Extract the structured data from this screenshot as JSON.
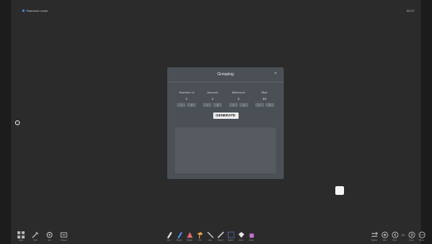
{
  "top": {
    "mode_label": "Standard mode",
    "time": "00:27"
  },
  "dialog": {
    "title": "Grouping",
    "close_symbol": "×",
    "params": [
      {
        "label": "Number of",
        "value": "1"
      },
      {
        "label": "Amount",
        "value": "1"
      },
      {
        "label": "Minimum",
        "value": "2"
      },
      {
        "label": "Max",
        "value": "10"
      }
    ],
    "decrement_symbol": "−",
    "increment_symbol": "+",
    "generate_label": "GENERATE"
  },
  "toolbar_left": [
    {
      "icon": "grid-icon",
      "label": "Apps"
    },
    {
      "icon": "tools-icon",
      "label": "Tool"
    },
    {
      "icon": "settings-icon",
      "label": "Set"
    },
    {
      "icon": "screenshot-icon",
      "label": "Screen"
    }
  ],
  "toolbar_center": [
    {
      "icon": "pen-icon",
      "label": "Pen",
      "color": "#e8e8e8"
    },
    {
      "icon": "brush-icon",
      "label": "Brush",
      "color": "#4a8fe0"
    },
    {
      "icon": "shape-icon",
      "label": "Shape",
      "color": "#e06a6a"
    },
    {
      "icon": "fill-icon",
      "label": "Fill",
      "color": "#e0a04a"
    },
    {
      "icon": "line-icon",
      "label": "Line",
      "color": "#cfcfcf"
    },
    {
      "icon": "pencil-icon",
      "label": "Pencil",
      "color": "#d8d8d8"
    },
    {
      "icon": "select-icon",
      "label": "Select",
      "color": "#6a88e0"
    },
    {
      "icon": "undo-icon",
      "label": "Undo",
      "color": "#e8e8e8"
    },
    {
      "icon": "eraser-icon",
      "label": "Clear",
      "color": "#c070d0"
    }
  ],
  "toolbar_right": [
    {
      "icon": "cast-icon",
      "label": "Switch"
    },
    {
      "icon": "add-page-icon",
      "label": "Add"
    },
    {
      "icon": "previous-page-icon",
      "label": "Prev"
    },
    {
      "icon": "next-page-icon",
      "label": "Next"
    },
    {
      "icon": "more-icon",
      "label": "More"
    }
  ],
  "page_indicator": "1/1"
}
